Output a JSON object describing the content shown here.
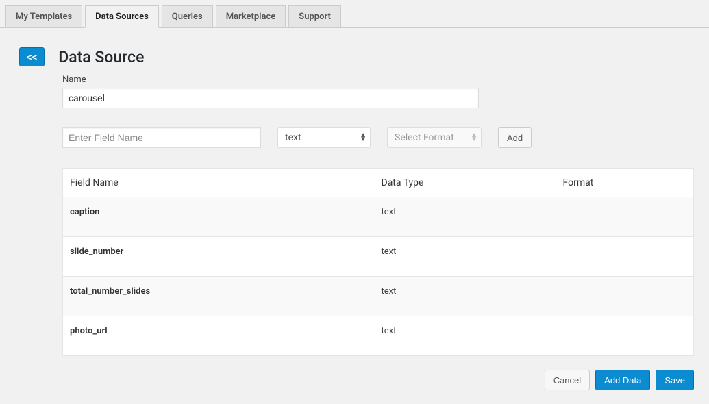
{
  "tabs": {
    "my_templates": "My Templates",
    "data_sources": "Data Sources",
    "queries": "Queries",
    "marketplace": "Marketplace",
    "support": "Support"
  },
  "page_title": "Data Source",
  "back_label": "<<",
  "name_label": "Name",
  "name_value": "carousel",
  "field_name_placeholder": "Enter Field Name",
  "type_select_value": "text",
  "format_select_value": "Select Format",
  "add_button": "Add",
  "columns": {
    "field_name": "Field Name",
    "data_type": "Data Type",
    "format": "Format"
  },
  "rows": [
    {
      "field_name": "caption",
      "data_type": "text",
      "format": ""
    },
    {
      "field_name": "slide_number",
      "data_type": "text",
      "format": ""
    },
    {
      "field_name": "total_number_slides",
      "data_type": "text",
      "format": ""
    },
    {
      "field_name": "photo_url",
      "data_type": "text",
      "format": ""
    }
  ],
  "footer": {
    "cancel": "Cancel",
    "add_data": "Add Data",
    "save": "Save"
  }
}
